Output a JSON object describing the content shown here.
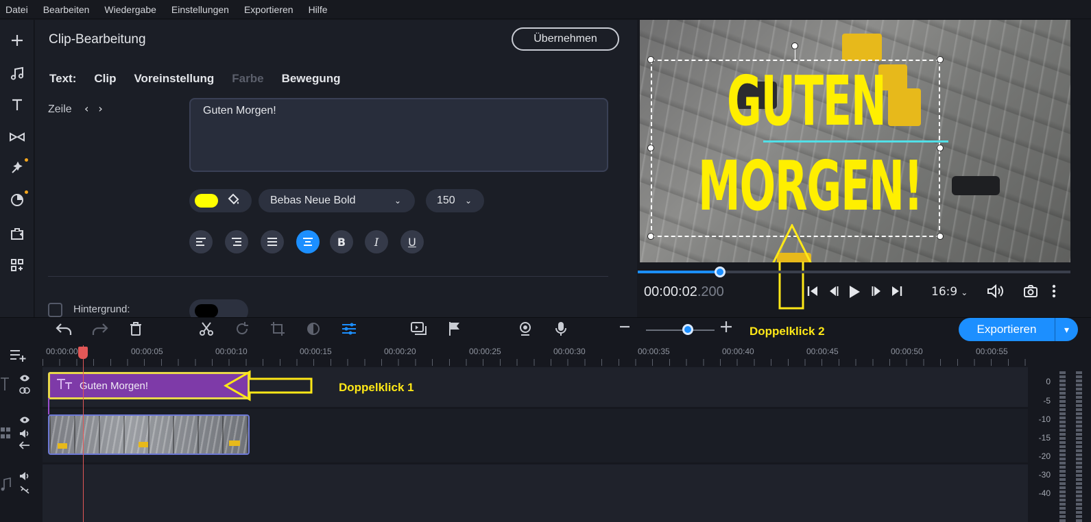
{
  "menu": [
    "Datei",
    "Bearbeiten",
    "Wiedergabe",
    "Einstellungen",
    "Exportieren",
    "Hilfe"
  ],
  "sidebar": {
    "icons": [
      "plus-icon",
      "music-icon",
      "text-icon",
      "transitions-icon",
      "effects-icon",
      "stickers-icon",
      "toolbox-icon",
      "more-icon"
    ]
  },
  "editor": {
    "title": "Clip-Bearbeitung",
    "apply_label": "Übernehmen",
    "tabs": [
      {
        "label": "Text:",
        "enabled": true
      },
      {
        "label": "Clip",
        "enabled": true
      },
      {
        "label": "Voreinstellung",
        "enabled": true
      },
      {
        "label": "Farbe",
        "enabled": false
      },
      {
        "label": "Bewegung",
        "enabled": true
      }
    ],
    "line_label": "Zeile",
    "line_nav": "< >",
    "text_value": "Guten Morgen!",
    "color_swatch": "#ffff00",
    "font_name": "Bebas Neue Bold",
    "font_size": "150",
    "background_label": "Hintergrund:",
    "format_buttons": [
      "align-left-icon",
      "align-right-icon",
      "justify-icon",
      "align-center-icon",
      "bold-icon",
      "italic-icon",
      "underline-icon"
    ]
  },
  "preview": {
    "overlay_line1": "GUTEN",
    "overlay_line2": "MORGEN!",
    "timecode_main": "00:00:02",
    "timecode_ms": ".200",
    "aspect_ratio": "16:9",
    "progress": 0.19
  },
  "timeline": {
    "export_label": "Exportieren",
    "annotation_1": "Doppelklick 1",
    "annotation_2": "Doppelklick 2",
    "ruler": [
      "00:00:00",
      "00:00:05",
      "00:00:10",
      "00:00:15",
      "00:00:20",
      "00:00:25",
      "00:00:30",
      "00:00:35",
      "00:00:40",
      "00:00:45",
      "00:00:50",
      "00:00:55"
    ],
    "text_clip_label": "Guten Morgen!",
    "meter_labels": [
      "0",
      "-5",
      "-10",
      "-15",
      "-20",
      "-30",
      "-40"
    ]
  }
}
